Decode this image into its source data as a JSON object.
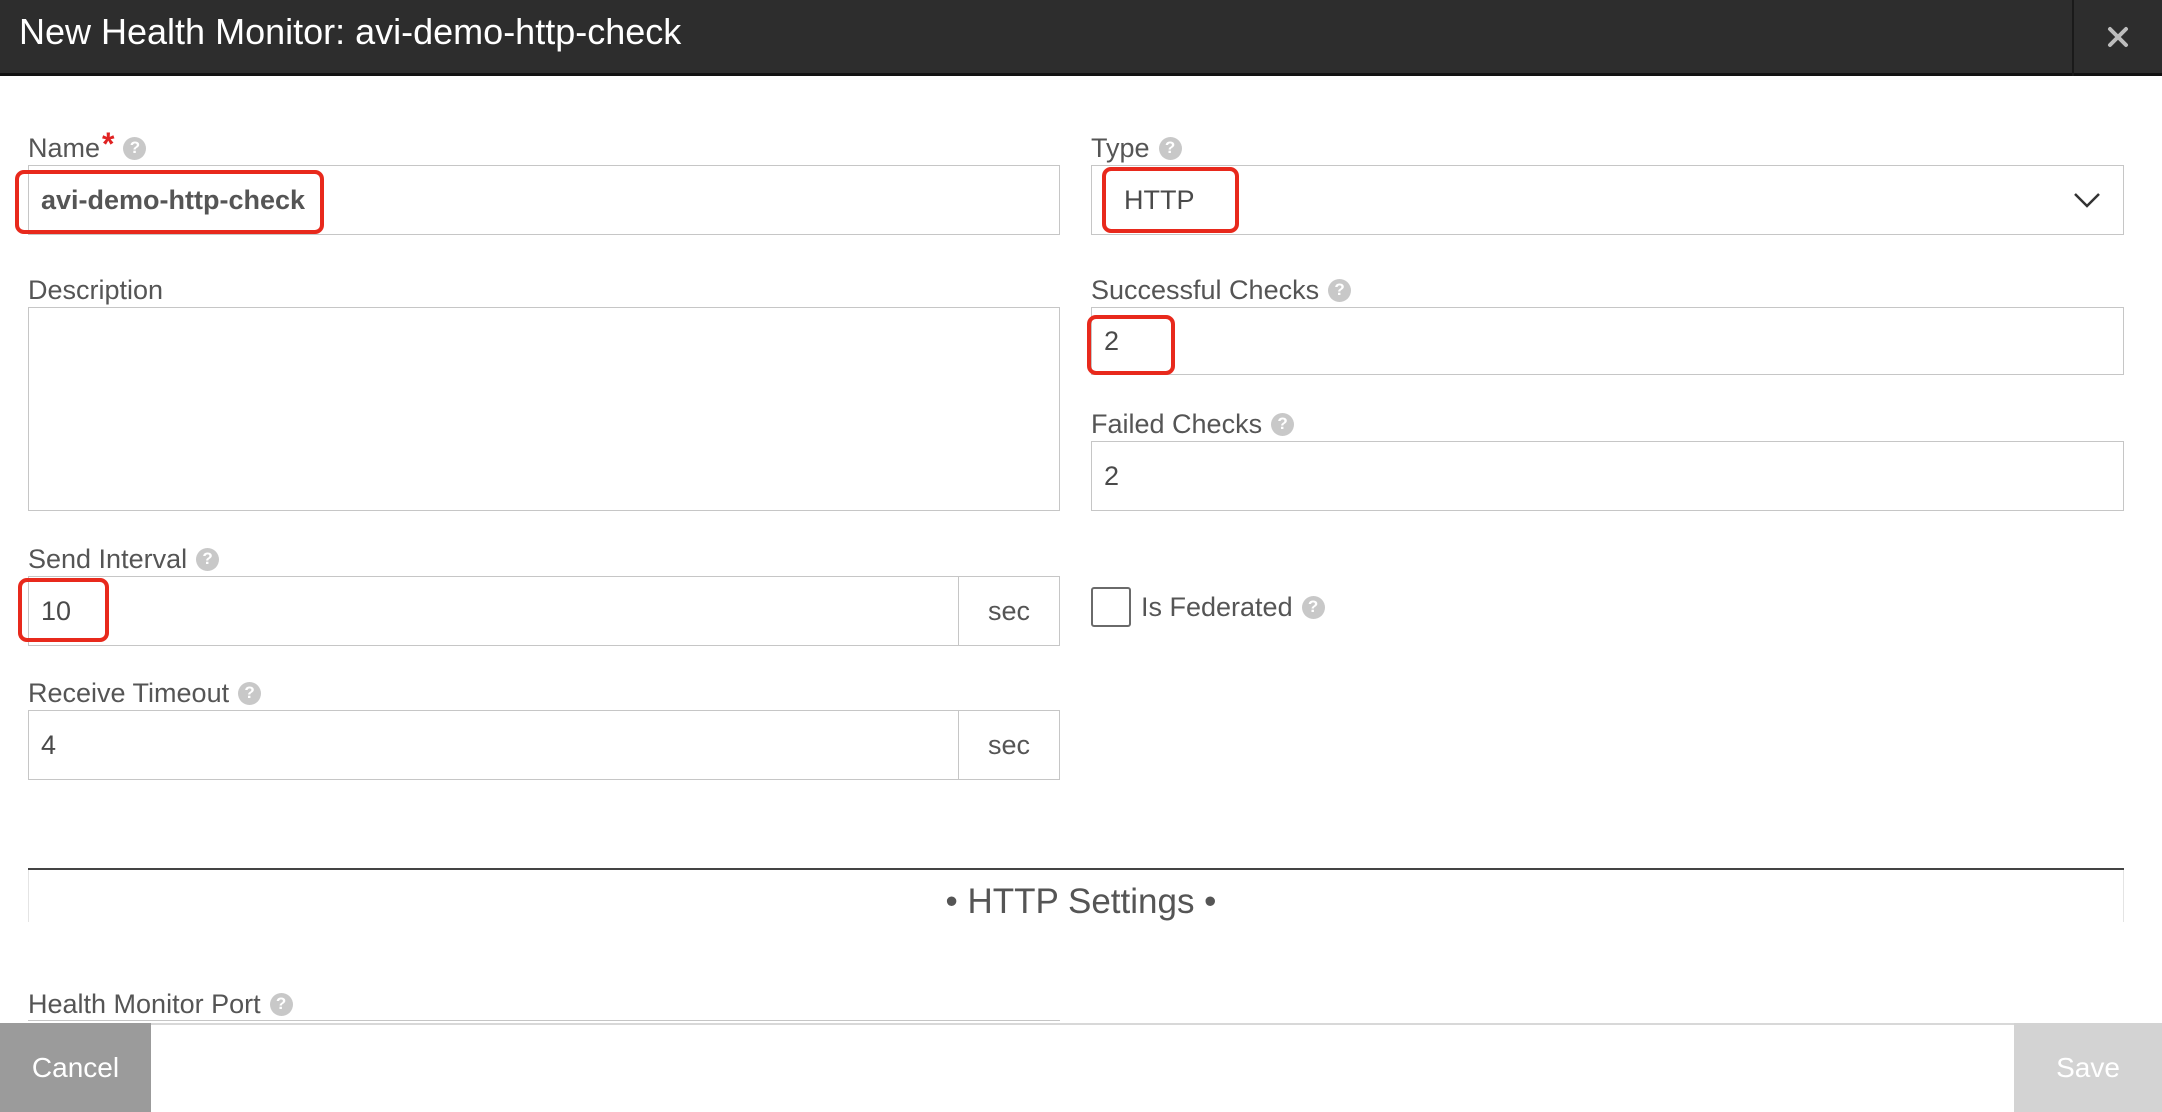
{
  "modal": {
    "title": "New Health Monitor: avi-demo-http-check",
    "close_icon": "close-icon"
  },
  "form": {
    "name": {
      "label": "Name",
      "required_mark": "*",
      "value": "avi-demo-http-check"
    },
    "type": {
      "label": "Type",
      "value": "HTTP"
    },
    "description": {
      "label": "Description",
      "value": ""
    },
    "successful_checks": {
      "label": "Successful Checks",
      "value": "2"
    },
    "failed_checks": {
      "label": "Failed Checks",
      "value": "2"
    },
    "send_interval": {
      "label": "Send Interval",
      "value": "10",
      "unit": "sec"
    },
    "receive_timeout": {
      "label": "Receive Timeout",
      "value": "4",
      "unit": "sec"
    },
    "is_federated": {
      "label": "Is Federated",
      "checked": false
    },
    "health_monitor_port": {
      "label": "Health Monitor Port"
    }
  },
  "section": {
    "http_settings": "• HTTP Settings •"
  },
  "footer": {
    "cancel_label": "Cancel",
    "save_label": "Save"
  },
  "help_glyph": "?",
  "colors": {
    "header_bg": "#2d2d2d",
    "highlight": "#e8291c",
    "required": "#e02222",
    "cancel_bg": "#9b9b9b",
    "save_bg": "#d3d3d3"
  }
}
